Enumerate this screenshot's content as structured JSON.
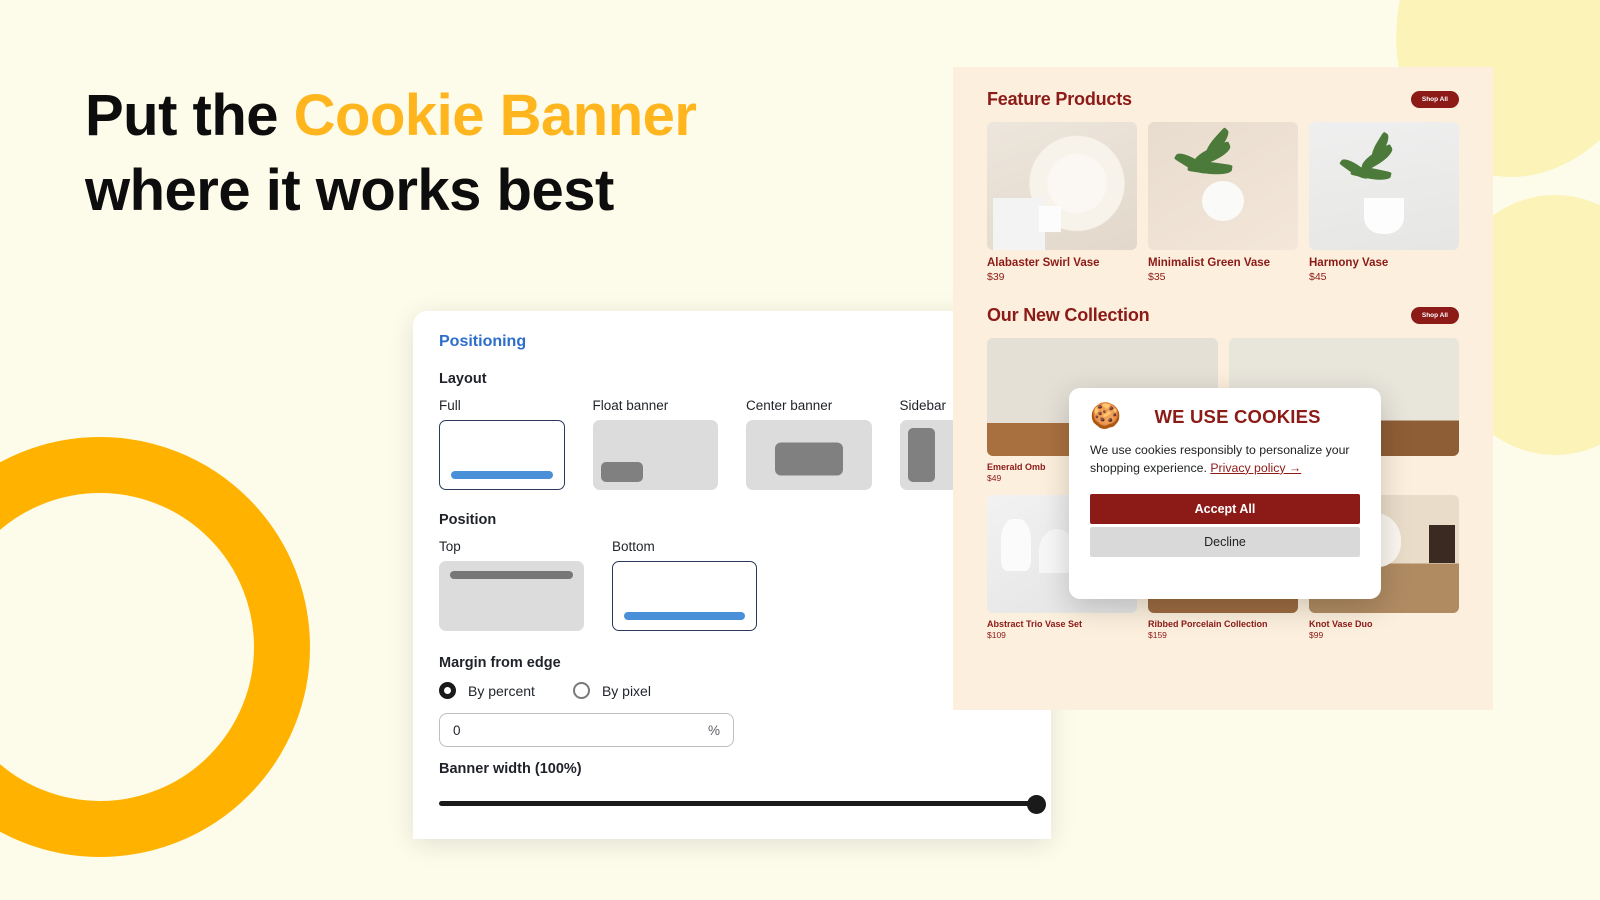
{
  "theme": {
    "page_bg": "#FDFBEA",
    "accent_yellow": "#FFB300",
    "headline_highlight": "#FFB61E",
    "brand_maroon": "#8C1A17",
    "store_bg": "#FCEFDD",
    "link_blue": "#2C6ECB",
    "select_blue": "#4A90D9"
  },
  "headline": {
    "line1_plain": "Put the ",
    "line1_highlight": "Cookie Banner",
    "line2": "where it works best"
  },
  "settings": {
    "section_title": "Positioning",
    "layout": {
      "title": "Layout",
      "options": [
        {
          "label": "Full",
          "icon": "full-width-banner-icon",
          "selected": true
        },
        {
          "label": "Float banner",
          "icon": "float-banner-icon",
          "selected": false
        },
        {
          "label": "Center banner",
          "icon": "center-banner-icon",
          "selected": false
        },
        {
          "label": "Sidebar",
          "icon": "sidebar-banner-icon",
          "selected": false
        }
      ]
    },
    "position": {
      "title": "Position",
      "options": [
        {
          "label": "Top",
          "icon": "position-top-icon",
          "selected": false
        },
        {
          "label": "Bottom",
          "icon": "position-bottom-icon",
          "selected": true
        }
      ]
    },
    "margin": {
      "title": "Margin from edge",
      "radios": [
        {
          "label": "By percent",
          "selected": true
        },
        {
          "label": "By pixel",
          "selected": false
        }
      ],
      "value": "0",
      "unit": "%"
    },
    "banner_width": {
      "label": "Banner width (100%)",
      "value": 100,
      "min": 0,
      "max": 100
    }
  },
  "store": {
    "sections": [
      {
        "title": "Feature Products",
        "shop_all_label": "Shop All",
        "products": [
          {
            "name": "Alabaster Swirl Vase",
            "price": "$39"
          },
          {
            "name": "Minimalist Green Vase",
            "price": "$35"
          },
          {
            "name": "Harmony Vase",
            "price": "$45"
          }
        ]
      },
      {
        "title": "Our New Collection",
        "shop_all_label": "Shop All",
        "products_row1": [
          {
            "name": "Emerald Omb",
            "price": "$49"
          },
          {
            "name": "",
            "price": ""
          }
        ],
        "products_row2": [
          {
            "name": "Abstract Trio Vase Set",
            "price": "$109"
          },
          {
            "name": "Ribbed Porcelain Collection",
            "price": "$159"
          },
          {
            "name": "Knot Vase Duo",
            "price": "$99"
          }
        ]
      }
    ]
  },
  "cookie_banner": {
    "icon": "cookie-icon",
    "icon_glyph": "🍪",
    "title": "WE USE COOKIES",
    "body_text": "We use cookies responsibly to personalize your shopping experience. ",
    "privacy_link": "Privacy policy →",
    "accept_label": "Accept All",
    "decline_label": "Decline"
  }
}
